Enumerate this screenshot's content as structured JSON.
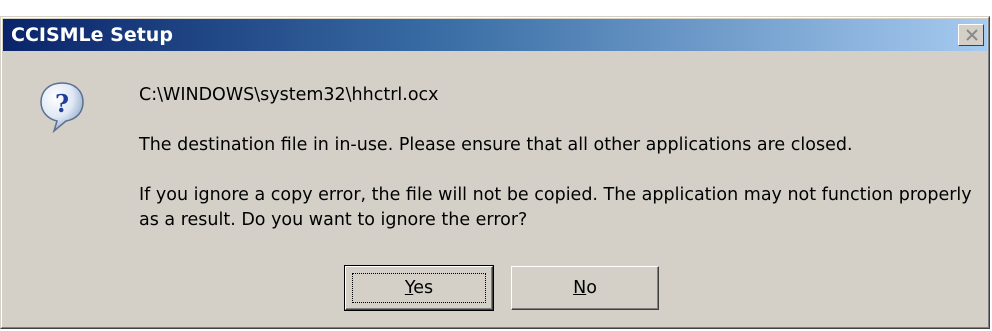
{
  "window": {
    "title": "CCISMLe Setup",
    "close_label": "×"
  },
  "message": {
    "file_path": "C:\\WINDOWS\\system32\\hhctrl.ocx",
    "destination_in_use": "The destination file in in-use.  Please ensure that all other applications are closed.",
    "ignore_prompt": "If you ignore a copy error, the file will not be copied.  The application may not function properly as a result.  Do you want to ignore the error?"
  },
  "buttons": {
    "yes": {
      "mnemonic": "Y",
      "rest": "es"
    },
    "no": {
      "mnemonic": "N",
      "rest": "o"
    }
  },
  "icons": {
    "dialog": "question-icon",
    "close": "close-icon"
  },
  "colors": {
    "title_start": "#0a246a",
    "title_end": "#a6caf0",
    "face": "#d4d0c8"
  }
}
